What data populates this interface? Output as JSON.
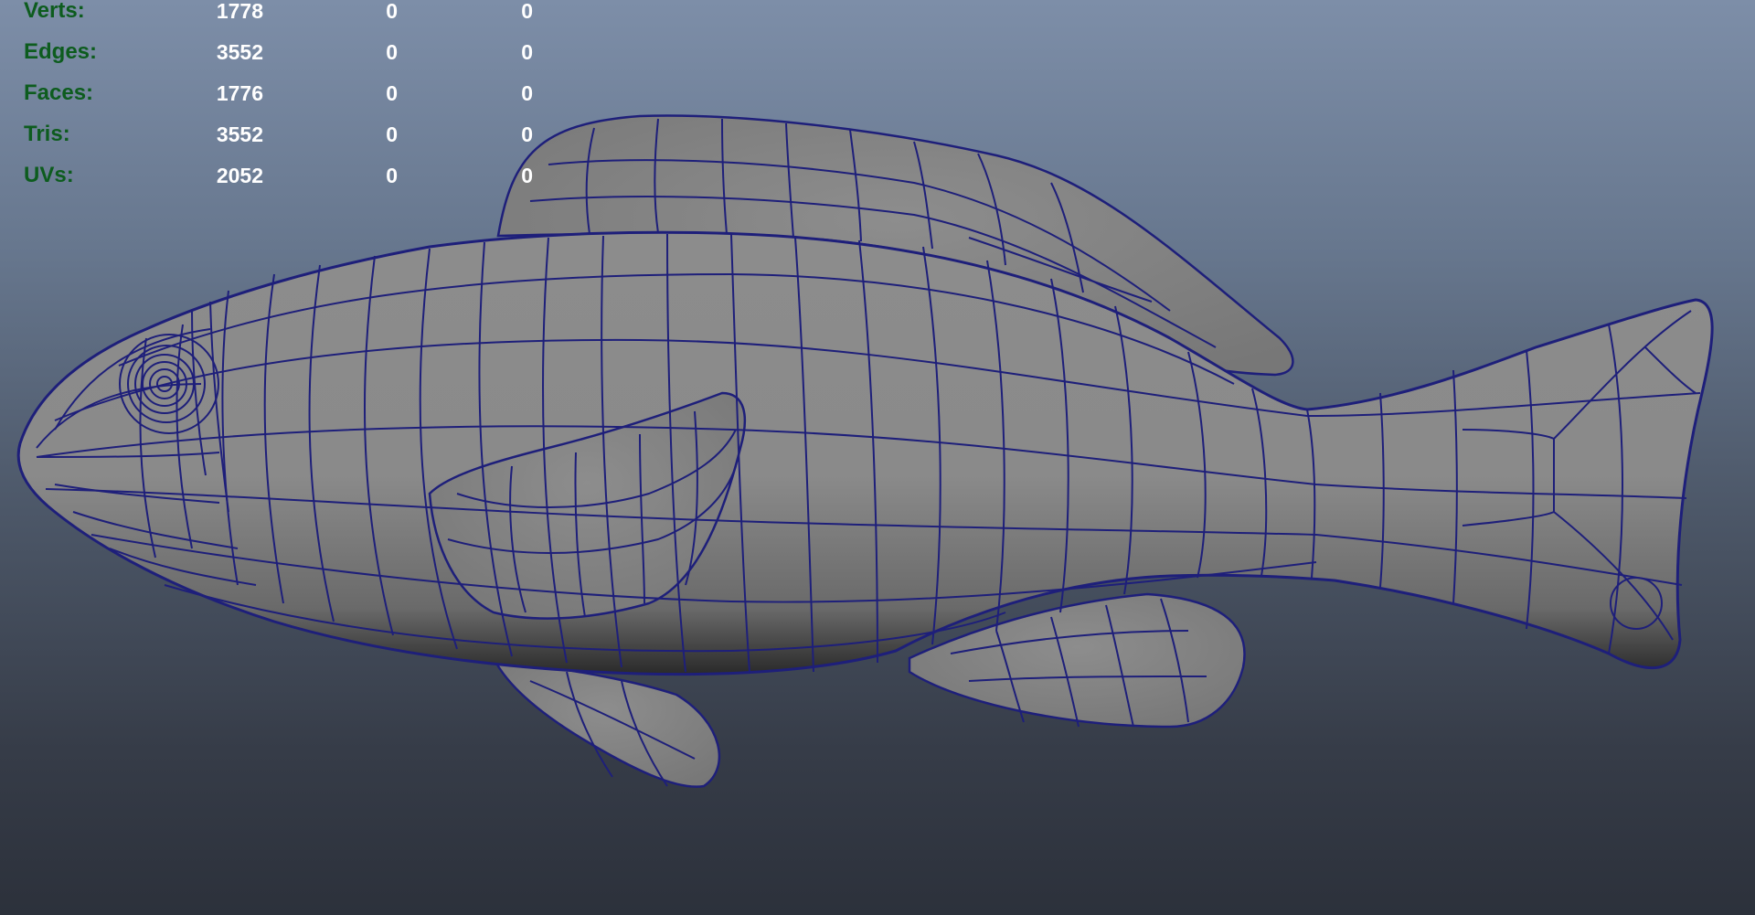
{
  "stats": [
    {
      "label": "Verts:",
      "values": [
        "1778",
        "0",
        "0"
      ]
    },
    {
      "label": "Edges:",
      "values": [
        "3552",
        "0",
        "0"
      ]
    },
    {
      "label": "Faces:",
      "values": [
        "1776",
        "0",
        "0"
      ]
    },
    {
      "label": "Tris:",
      "values": [
        "3552",
        "0",
        "0"
      ]
    },
    {
      "label": "UVs:",
      "values": [
        "2052",
        "0",
        "0"
      ]
    }
  ],
  "colors": {
    "hud_label": "#0d5c1e",
    "hud_value": "#ffffff",
    "wireframe": "#1e1f7a",
    "mesh_fill": "#8a8a8a"
  }
}
